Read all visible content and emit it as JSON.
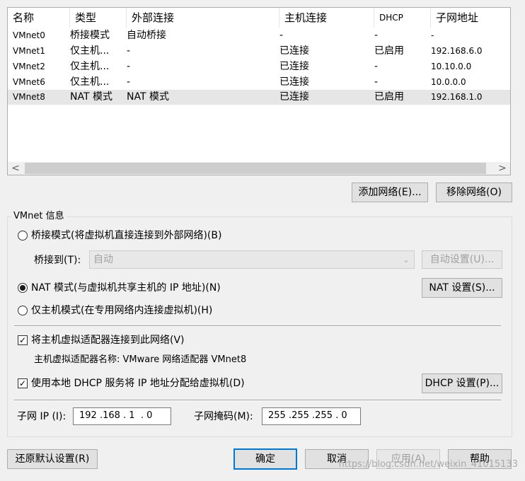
{
  "network_table": {
    "columns": [
      "名称",
      "类型",
      "外部连接",
      "主机连接",
      "DHCP",
      "子网地址"
    ],
    "rows": [
      {
        "name": "VMnet0",
        "type": "桥接模式",
        "external": "自动桥接",
        "host": "-",
        "dhcp": "-",
        "subnet": "-"
      },
      {
        "name": "VMnet1",
        "type": "仅主机...",
        "external": "-",
        "host": "已连接",
        "dhcp": "已启用",
        "subnet": "192.168.6.0"
      },
      {
        "name": "VMnet2",
        "type": "仅主机...",
        "external": "-",
        "host": "已连接",
        "dhcp": "-",
        "subnet": "10.10.0.0"
      },
      {
        "name": "VMnet6",
        "type": "仅主机...",
        "external": "-",
        "host": "已连接",
        "dhcp": "-",
        "subnet": "10.0.0.0"
      },
      {
        "name": "VMnet8",
        "type": "NAT 模式",
        "external": "NAT 模式",
        "host": "已连接",
        "dhcp": "已启用",
        "subnet": "192.168.1.0"
      }
    ],
    "selected_row": "VMnet8",
    "scroll_left": "<",
    "scroll_right": ">"
  },
  "buttons": {
    "add_network": "添加网络(E)...",
    "remove_network": "移除网络(O)",
    "auto_settings": "自动设置(U)...",
    "nat_settings": "NAT 设置(S)...",
    "dhcp_settings": "DHCP 设置(P)...",
    "restore_defaults": "还原默认设置(R)",
    "ok": "确定",
    "cancel": "取消",
    "apply": "应用(A)",
    "help": "帮助"
  },
  "vmnet_info": {
    "title": "VMnet 信息",
    "radio_bridged": "桥接模式(将虚拟机直接连接到外部网络)(B)",
    "bridge_to_label": "桥接到(T):",
    "bridge_to_value": "自动",
    "radio_nat": "NAT 模式(与虚拟机共享主机的 IP 地址)(N)",
    "radio_host_only": "仅主机模式(在专用网络内连接虚拟机)(H)",
    "selected_mode": "nat",
    "check_connect_adapter": "将主机虚拟适配器连接到此网络(V)",
    "adapter_name_text": "主机虚拟适配器名称: VMware 网络适配器 VMnet8",
    "check_dhcp": "使用本地 DHCP 服务将 IP 地址分配给虚拟机(D)",
    "subnet_ip_label": "子网 IP (I):",
    "subnet_ip_value": "192 .168 . 1  . 0",
    "subnet_mask_label": "子网掩码(M):",
    "subnet_mask_value": "255 .255 .255 . 0"
  },
  "watermark": "https://blog.csdn.net/weixin_41015133",
  "colors": {
    "selected_row": "#e6e6e6",
    "focus_border": "#0078d7",
    "dialog_bg": "#f0f0f0"
  }
}
